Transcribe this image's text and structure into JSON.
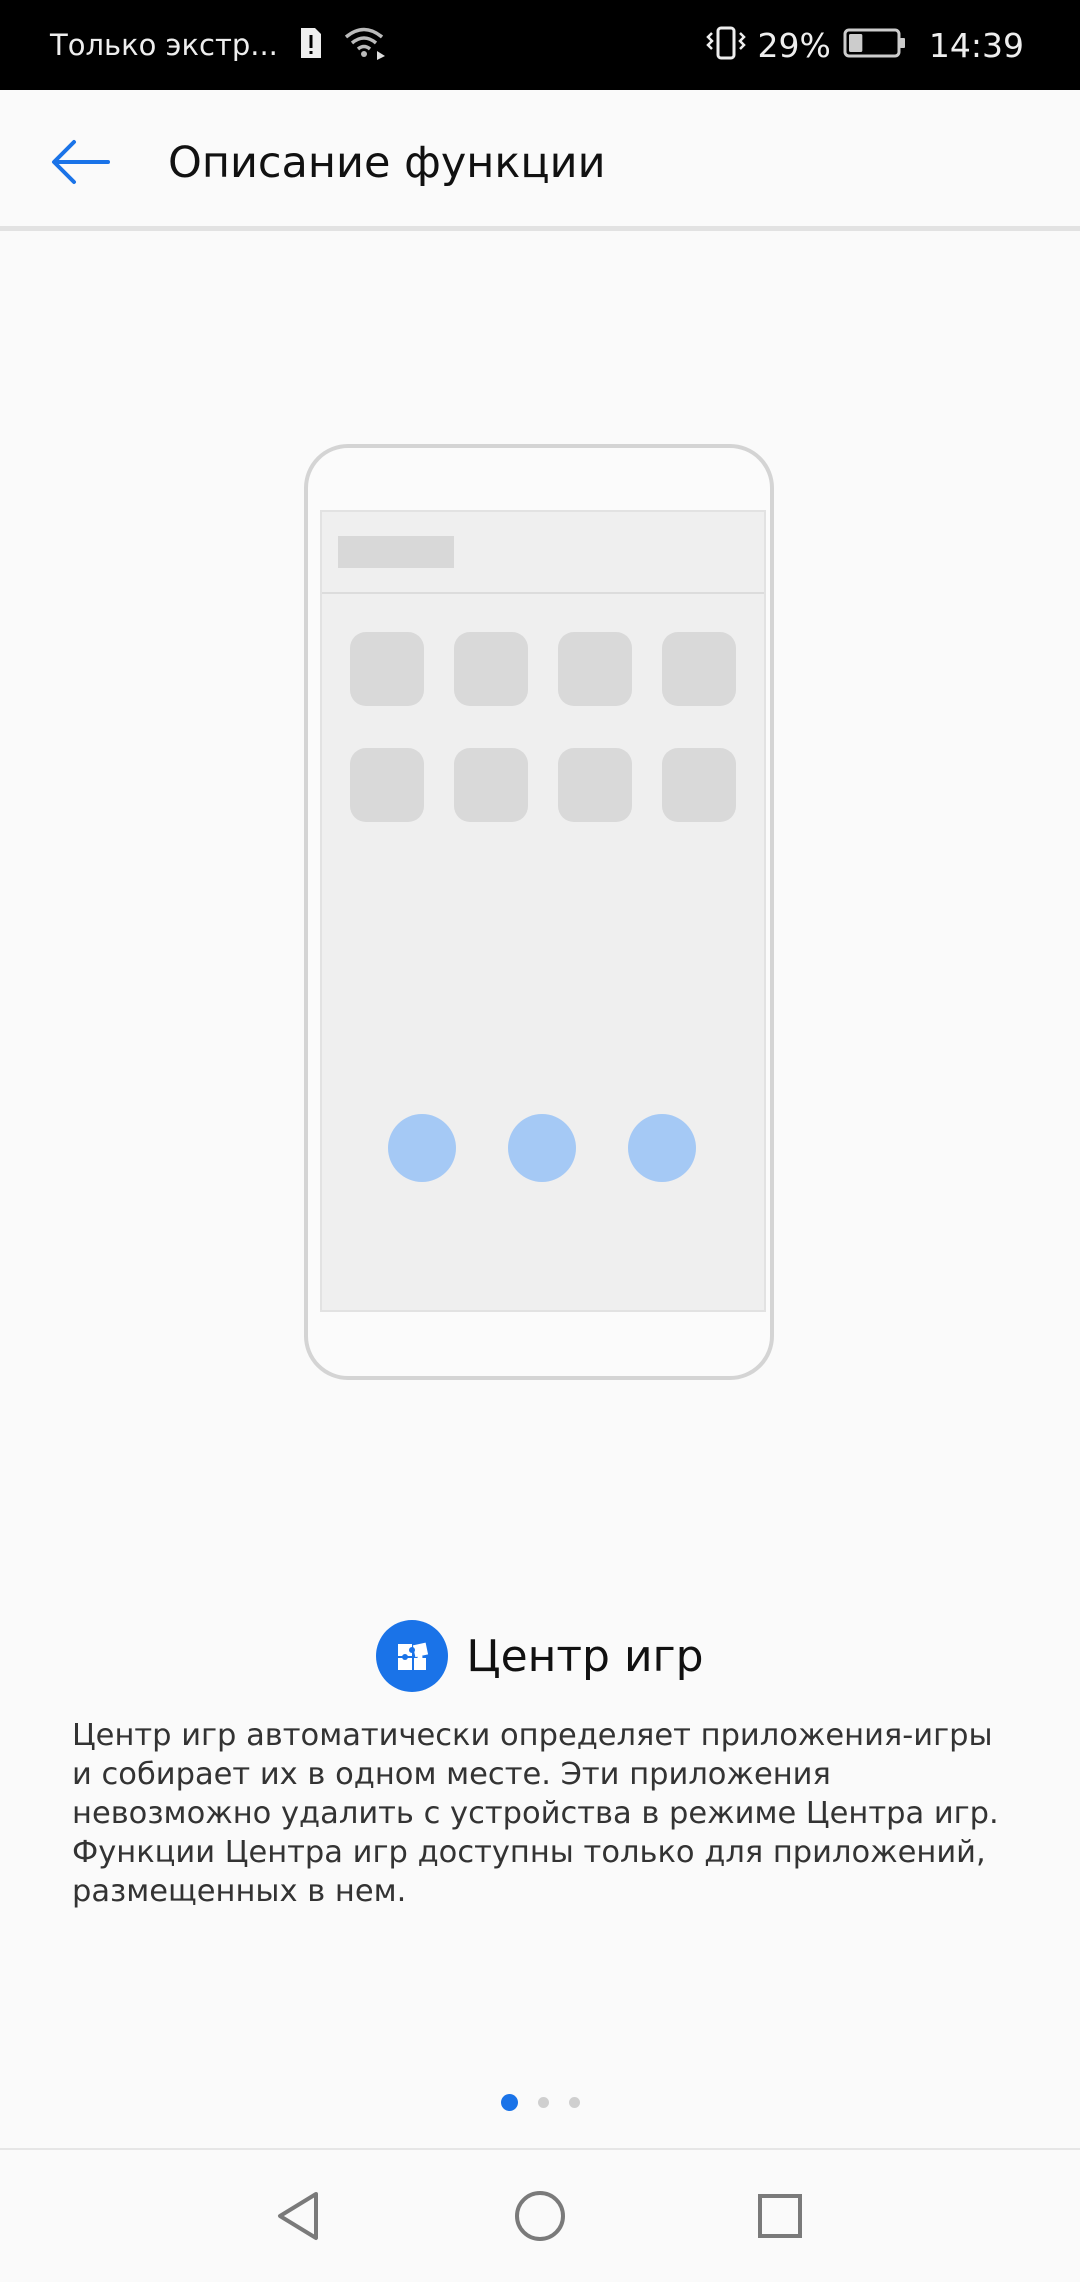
{
  "status_bar": {
    "carrier": "Только экстр...",
    "battery_percent": "29%",
    "battery_level": 0.29,
    "time": "14:39",
    "icons": [
      "alert-sim-icon",
      "wifi-icon",
      "vibrate-icon",
      "battery-icon"
    ]
  },
  "header": {
    "title": "Описание функции",
    "back_icon": "back-arrow-icon"
  },
  "feature": {
    "title": "Центр игр",
    "icon": "game-center-icon",
    "description": "Центр игр автоматически определяет приложения-игры и собирает их в одном месте. Эти приложения невозможно удалить с устройства в режиме Центра игр. Функции Центра игр доступны только для приложений, размещенных в нем."
  },
  "pager": {
    "pages": 3,
    "current": 1
  },
  "nav_bar": {
    "buttons": [
      "back-triangle-icon",
      "home-circle-icon",
      "recents-square-icon"
    ]
  },
  "colors": {
    "accent": "#1a73e8",
    "illustration_dot": "#a5c9f5",
    "status_bar_bg": "#000000",
    "background": "#fafafa"
  }
}
